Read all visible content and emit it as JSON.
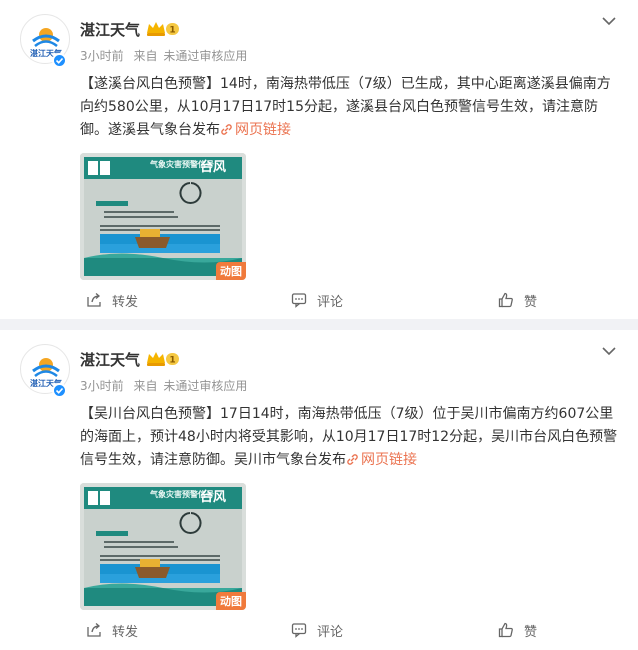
{
  "posts": [
    {
      "author": "湛江天气",
      "time": "3小时前",
      "source_prefix": "来自",
      "source": "未通过审核应用",
      "title": "【遂溪台风白色预警】",
      "body": "14时，南海热带低压（7级）已生成，其中心距离遂溪县偏南方向约580公里，从10月17日17时15分起，遂溪县台风白色预警信号生效，请注意防御。遂溪县气象台发布",
      "link_text": "网页链接",
      "thumb_heading": "气象灾害预警信号",
      "thumb_type": "台风",
      "gif_label": "动图",
      "share_label": "转发",
      "comment_label": "评论",
      "like_label": "赞"
    },
    {
      "author": "湛江天气",
      "time": "3小时前",
      "source_prefix": "来自",
      "source": "未通过审核应用",
      "title": "【吴川台风白色预警】",
      "body": "17日14时，南海热带低压（7级）位于吴川市偏南方约607公里的海面上，预计48小时内将受其影响，从10月17日17时12分起，吴川市台风白色预警信号生效，请注意防御。吴川市气象台发布",
      "link_text": "网页链接",
      "thumb_heading": "气象灾害预警信号",
      "thumb_type": "台风",
      "gif_label": "动图",
      "share_label": "转发",
      "comment_label": "评论",
      "like_label": "赞"
    }
  ],
  "avatar_text": "湛江天气",
  "level_badge": "1",
  "colors": {
    "link": "#eb7350",
    "verified": "#1e90ff",
    "meta": "#939393",
    "background": "#f1f2f5",
    "thumb_teal": "#1f8a7f"
  },
  "icons": [
    "more-chevron-icon",
    "link-icon",
    "share-icon",
    "comment-icon",
    "like-icon",
    "verified-icon",
    "crown-icon"
  ]
}
